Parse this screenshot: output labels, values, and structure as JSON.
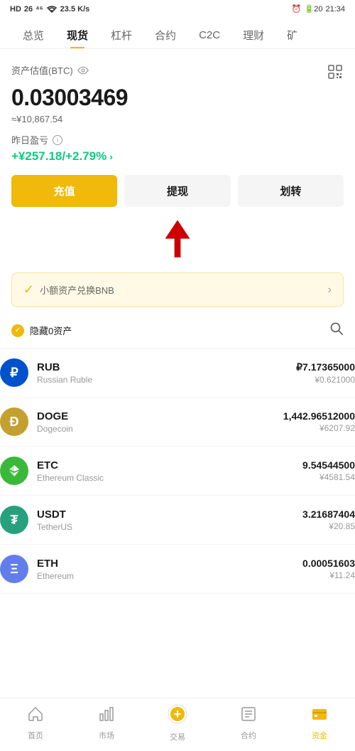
{
  "statusBar": {
    "left": "HD 26 46",
    "speed": "23.5 K/s",
    "time": "21:34"
  },
  "nav": {
    "items": [
      {
        "label": "总览",
        "active": false
      },
      {
        "label": "现货",
        "active": true
      },
      {
        "label": "杠杆",
        "active": false
      },
      {
        "label": "合约",
        "active": false
      },
      {
        "label": "C2C",
        "active": false
      },
      {
        "label": "理财",
        "active": false
      },
      {
        "label": "矿",
        "active": false
      }
    ]
  },
  "asset": {
    "label": "资产估值(BTC)",
    "btcValue": "0.03003469",
    "cnyApprox": "≈¥10,867.54",
    "pnlLabel": "昨日盈亏",
    "pnlValue": "+¥257.18/+2.79%"
  },
  "buttons": {
    "deposit": "充值",
    "withdraw": "提现",
    "transfer": "划转"
  },
  "bnbBanner": {
    "text": "小额资产兑换BNB"
  },
  "filter": {
    "hideZeroText": "隐藏0资产"
  },
  "coins": [
    {
      "symbol": "RUB",
      "name": "Russian Ruble",
      "amount": "₽7.17365000",
      "cny": "¥0.621000",
      "iconColor": "coin-rub",
      "iconText": "₽"
    },
    {
      "symbol": "DOGE",
      "name": "Dogecoin",
      "amount": "1,442.96512000",
      "cny": "¥6207.92",
      "iconColor": "coin-doge",
      "iconText": "Ð"
    },
    {
      "symbol": "ETC",
      "name": "Ethereum Classic",
      "amount": "9.54544500",
      "cny": "¥4581.54",
      "iconColor": "coin-etc",
      "iconText": "◆"
    },
    {
      "symbol": "USDT",
      "name": "TetherUS",
      "amount": "3.21687404",
      "cny": "¥20.85",
      "iconColor": "coin-usdt",
      "iconText": "₮"
    },
    {
      "symbol": "ETH",
      "name": "Ethereum",
      "amount": "0.00051603",
      "cny": "¥11.24",
      "iconColor": "coin-eth",
      "iconText": "Ξ"
    }
  ],
  "bottomNav": [
    {
      "label": "首页",
      "icon": "🏠",
      "active": false
    },
    {
      "label": "市场",
      "icon": "📊",
      "active": false
    },
    {
      "label": "交易",
      "icon": "🔄",
      "active": false
    },
    {
      "label": "合约",
      "icon": "📋",
      "active": false
    },
    {
      "label": "资金",
      "icon": "💼",
      "active": true
    }
  ]
}
